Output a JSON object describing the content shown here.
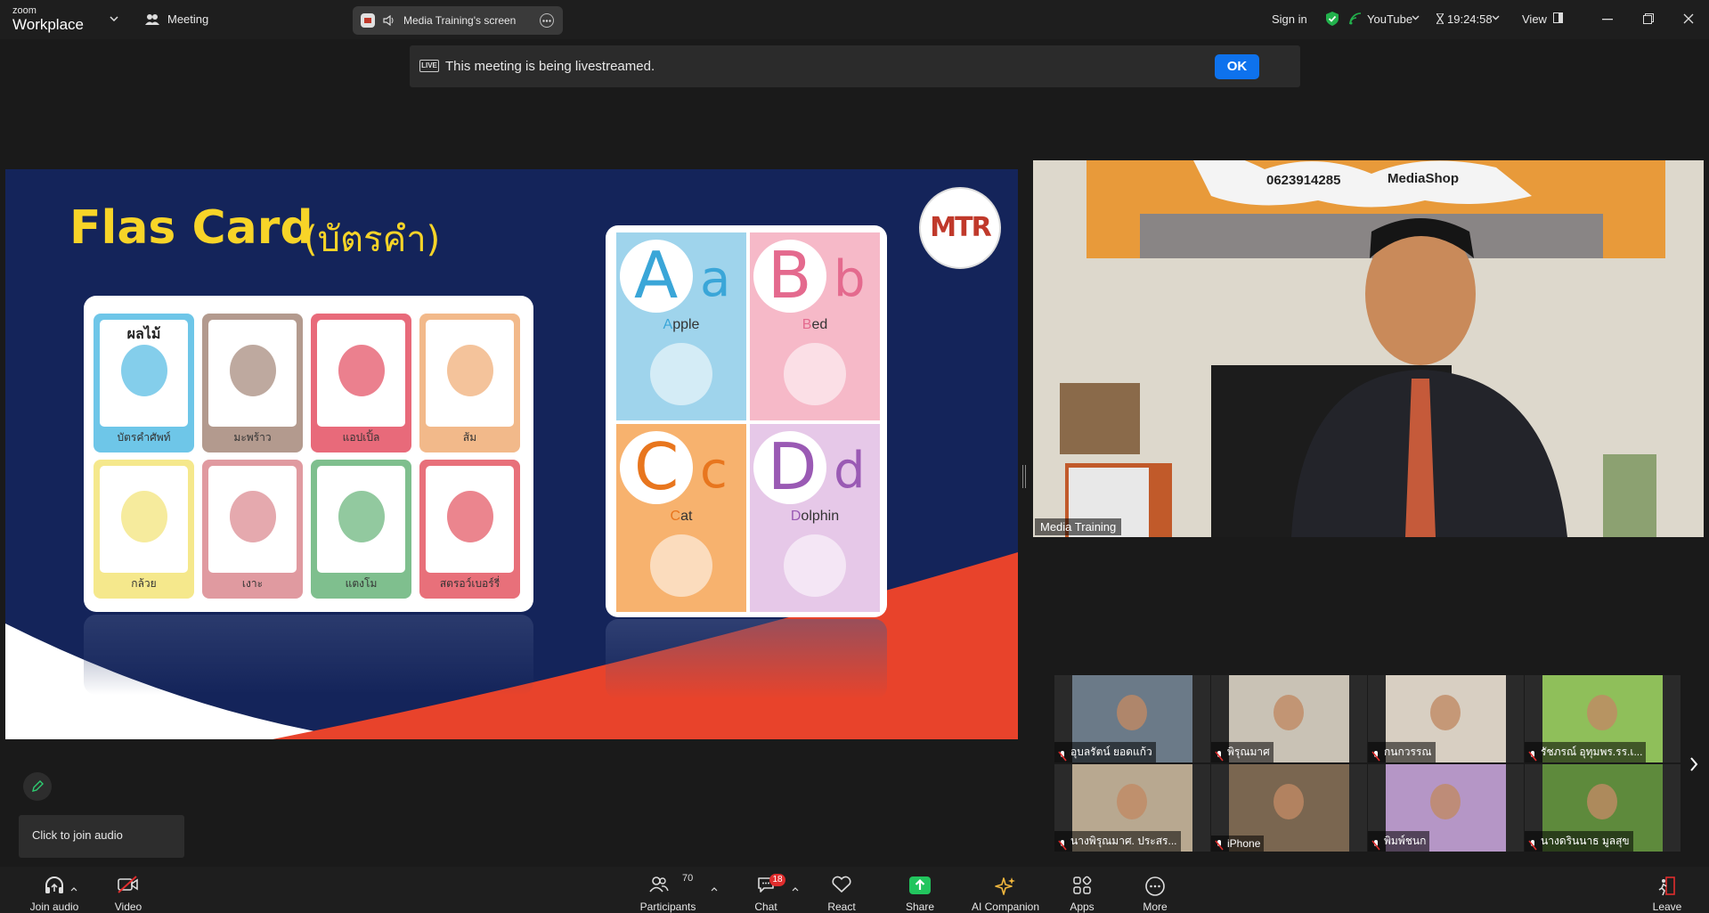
{
  "topbar": {
    "brand_small": "zoom",
    "brand_large": "Workplace",
    "meeting_label": "Meeting",
    "screen_tab_label": "Media Training's screen",
    "sign_in": "Sign in",
    "livestream_label": "YouTube",
    "timer": "19:24:58",
    "view_label": "View"
  },
  "banner": {
    "live_badge": "LIVE",
    "text": "This meeting is being livestreamed.",
    "ok_label": "OK"
  },
  "slide": {
    "title": "Flas Card",
    "subtitle": "(บัตรคำ)",
    "logo_text": "MTR",
    "fruit_cards": [
      {
        "label": "บัตรคำศัพท์",
        "header": "ผลไม้",
        "color": "#6ec6e8"
      },
      {
        "label": "มะพร้าว",
        "color": "#b39a8e"
      },
      {
        "label": "แอปเปิ้ล",
        "color": "#e86a7a"
      },
      {
        "label": "ส้ม",
        "color": "#f2b98a"
      },
      {
        "label": "กล้วย",
        "color": "#f5e88c"
      },
      {
        "label": "เงาะ",
        "color": "#e09aa0"
      },
      {
        "label": "แตงโม",
        "color": "#7fbf8e"
      },
      {
        "label": "สตรอว์เบอร์รี่",
        "color": "#e8707a"
      }
    ],
    "alphabet_cards": [
      {
        "upper": "A",
        "lower": "a",
        "word_initial": "A",
        "word_rest": "pple",
        "color": "#9fd4ec",
        "letter_color": "#3aa6d8"
      },
      {
        "upper": "B",
        "lower": "b",
        "word_initial": "B",
        "word_rest": "ed",
        "color": "#f6b9c8",
        "letter_color": "#e46a8e"
      },
      {
        "upper": "C",
        "lower": "c",
        "word_initial": "C",
        "word_rest": "at",
        "color": "#f7b26e",
        "letter_color": "#e8761e"
      },
      {
        "upper": "D",
        "lower": "d",
        "word_initial": "D",
        "word_rest": "olphin",
        "color": "#e6c8e8",
        "letter_color": "#9a5ab4"
      }
    ]
  },
  "speaker": {
    "name": "Media Training",
    "phone": "0623914285",
    "shop": "MediaShop"
  },
  "gallery": {
    "tiles": [
      {
        "name": "อุบลรัตน์ ยอดแก้ว",
        "bg": "#6b7a88"
      },
      {
        "name": "พิรุณมาศ",
        "bg": "#c9c2b5"
      },
      {
        "name": "กนกวรรณ",
        "bg": "#d8cfc2"
      },
      {
        "name": "รัชภรณ์ อุทุมพร.รร.เ...",
        "bg": "#8fbf5a"
      },
      {
        "name": "นางพิรุณมาศ. ประสร...",
        "bg": "#b8a890"
      },
      {
        "name": "iPhone",
        "bg": "#7a6650"
      },
      {
        "name": "พิมพ์ชนก",
        "bg": "#b596c6"
      },
      {
        "name": "นางดรินนาธ มูลสุข",
        "bg": "#5e8a3c"
      }
    ]
  },
  "toolbar": {
    "join_audio": "Join audio",
    "video": "Video",
    "participants": "Participants",
    "participants_count": "70",
    "chat": "Chat",
    "chat_badge": "18",
    "react": "React",
    "share": "Share",
    "ai_companion": "AI Companion",
    "apps": "Apps",
    "more": "More",
    "leave": "Leave"
  },
  "tooltip": {
    "text": "Click to join audio"
  },
  "colors": {
    "accent": "#0e72ed",
    "share_green": "#22c55e",
    "badge_red": "#e02d2d",
    "slide_navy": "#14245a",
    "slide_red": "#e8432b",
    "title_yellow": "#f7d428"
  }
}
